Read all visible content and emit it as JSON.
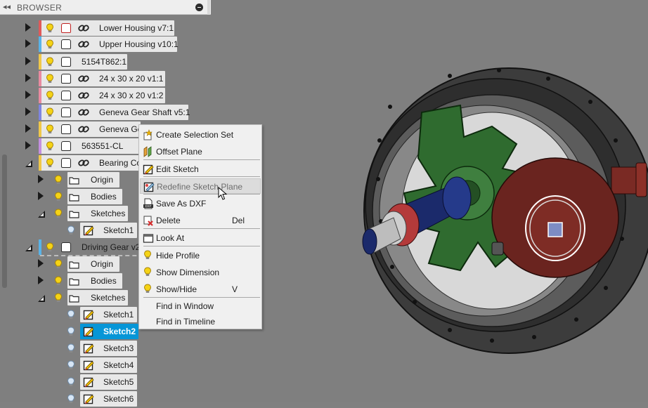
{
  "browser": {
    "title": "BROWSER",
    "collapse_glyph": "◂◂"
  },
  "tree": [
    {
      "label": "Lower Housing v7:1",
      "stripe": "#e05a5a"
    },
    {
      "label": "Upper Housing v10:1",
      "stripe": "#59b3e8"
    },
    {
      "label": "5154T862:1",
      "stripe": "#f0c84a"
    },
    {
      "label": "24 x 30 x 20 v1:1",
      "stripe": "#e98aa0"
    },
    {
      "label": "24 x 30 x 20 v1:2",
      "stripe": "#e98aa0"
    },
    {
      "label": "Geneva Gear Shaft v5:1",
      "stripe": "#7e85e0"
    },
    {
      "label": "Geneva Ge",
      "stripe": "#f0c84a"
    },
    {
      "label": "563551-CL",
      "stripe": "#c48fe0"
    },
    {
      "label": "Bearing Co",
      "stripe": "#f0c84a"
    },
    {
      "label": "Origin"
    },
    {
      "label": "Bodies"
    },
    {
      "label": "Sketches"
    },
    {
      "label": "Sketch1"
    },
    {
      "label": "Driving Gear v2:",
      "stripe": "#59b3e8"
    },
    {
      "label": "Origin"
    },
    {
      "label": "Bodies"
    },
    {
      "label": "Sketches"
    },
    {
      "label": "Sketch1"
    },
    {
      "label": "Sketch2",
      "selected": true
    },
    {
      "label": "Sketch3"
    },
    {
      "label": "Sketch4"
    },
    {
      "label": "Sketch5"
    },
    {
      "label": "Sketch6"
    }
  ],
  "context_menu": {
    "items": [
      {
        "label": "Create Selection Set",
        "icon": "selection-set-icon"
      },
      {
        "label": "Offset Plane",
        "icon": "offset-plane-icon"
      },
      {
        "label": "Edit Sketch",
        "icon": "edit-sketch-icon"
      },
      {
        "label": "Redefine Sketch Plane",
        "icon": "redefine-sketch-plane-icon",
        "state": "hover"
      },
      {
        "label": "Save As DXF",
        "icon": "dxf-icon"
      },
      {
        "label": "Delete",
        "icon": "delete-icon",
        "shortcut": "Del"
      },
      {
        "label": "Look At",
        "icon": "look-at-icon"
      },
      {
        "label": "Hide Profile",
        "icon": "bulb-icon"
      },
      {
        "label": "Show Dimension",
        "icon": "bulb-icon"
      },
      {
        "label": "Show/Hide",
        "icon": "bulb-icon",
        "shortcut": "V"
      },
      {
        "label": "Find in Window"
      },
      {
        "label": "Find in Timeline"
      }
    ]
  },
  "colors": {
    "viewport": "#7f7f7f",
    "housing": "#3a3a3a",
    "geneva_gear": "#2f6b2f",
    "driving_gear": "#7a2a24",
    "shaft_blue": "#1b2a6b",
    "selection": "#0696d7"
  }
}
